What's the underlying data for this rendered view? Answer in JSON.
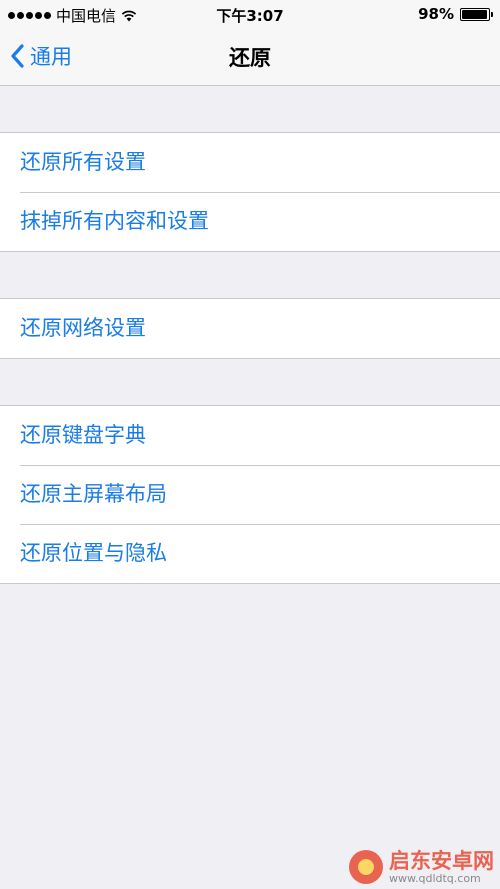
{
  "status_bar": {
    "carrier": "中国电信",
    "time": "下午3:07",
    "battery_percent": "98%",
    "battery_level": 0.98
  },
  "nav": {
    "back_label": "通用",
    "title": "还原"
  },
  "groups": [
    {
      "items": [
        "还原所有设置",
        "抹掉所有内容和设置"
      ]
    },
    {
      "items": [
        "还原网络设置"
      ]
    },
    {
      "items": [
        "还原键盘字典",
        "还原主屏幕布局",
        "还原位置与隐私"
      ]
    }
  ],
  "watermark": {
    "name": "启东安卓网",
    "url": "www.qdldtq.com"
  },
  "colors": {
    "accent": "#1a7ce6",
    "background": "#efeff4",
    "separator": "#c8c7cc"
  }
}
